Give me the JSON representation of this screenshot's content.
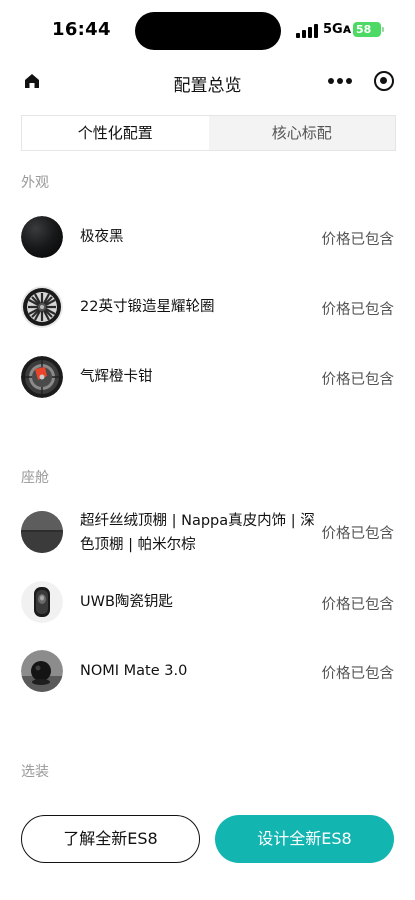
{
  "status_bar": {
    "time": "16:44",
    "network": "5Gᴀ",
    "battery": "58"
  },
  "nav": {
    "title": "配置总览",
    "home_icon": "home-icon",
    "more_icon": "more-dots-icon",
    "target_icon": "target-icon"
  },
  "tabs": [
    {
      "label": "个性化配置",
      "active": true
    },
    {
      "label": "核心标配",
      "active": false
    }
  ],
  "sections": {
    "appearance": {
      "label": "外观",
      "items": [
        {
          "name": "极夜黑",
          "price": "价格已包含"
        },
        {
          "name": "22英寸锻造星耀轮圈",
          "price": "价格已包含"
        },
        {
          "name": "气辉橙卡钳",
          "price": "价格已包含"
        }
      ]
    },
    "cabin": {
      "label": "座舱",
      "items": [
        {
          "name": "超纤丝绒顶棚 | Nappa真皮内饰 | 深色顶棚 | 帕米尔棕",
          "price": "价格已包含"
        },
        {
          "name": "UWB陶瓷钥匙",
          "price": "价格已包含"
        },
        {
          "name": "NOMI Mate 3.0",
          "price": "价格已包含"
        }
      ]
    },
    "options": {
      "label": "选装"
    }
  },
  "buttons": {
    "learn": "了解全新ES8",
    "design": "设计全新ES8"
  },
  "colors": {
    "accent": "#13b5b1",
    "battery": "#4cd964"
  }
}
